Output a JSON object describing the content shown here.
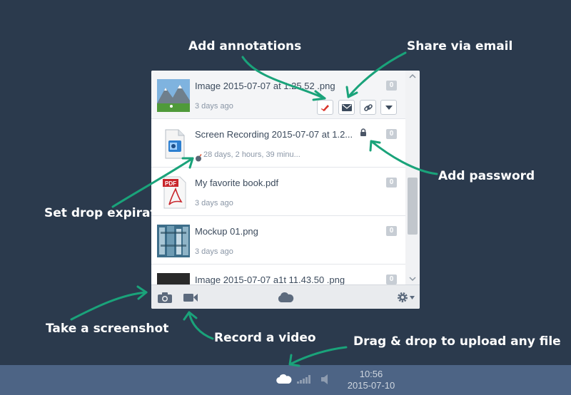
{
  "callouts": {
    "add_annotations": "Add annotations",
    "share_email": "Share via email",
    "add_password": "Add password",
    "set_expiration": "Set drop expiration",
    "take_screenshot": "Take a screenshot",
    "record_video": "Record a video",
    "drag_drop": "Drag & drop to upload any file"
  },
  "files": [
    {
      "name": "Image 2015-07-07 at 1.25.52 .png",
      "meta": "3 days ago",
      "count": "0",
      "thumb": "mountain-thumbnail"
    },
    {
      "name": "Screen Recording 2015-07-07 at 1.2...",
      "meta": "28 days, 2 hours, 39 minu...",
      "count": "0",
      "thumb": "video-file-icon"
    },
    {
      "name": "My favorite book.pdf",
      "meta": "3 days ago",
      "count": "0",
      "thumb": "pdf-file-icon"
    },
    {
      "name": "Mockup 01.png",
      "meta": "3 days ago",
      "count": "0",
      "thumb": "mockup-thumbnail"
    },
    {
      "name": "Image 2015-07-07 a1t 11.43.50 .png",
      "meta": "",
      "count": "0",
      "thumb": "dark-thumbnail"
    }
  ],
  "toolbar": {
    "icons": [
      "camera-icon",
      "video-camera-icon",
      "cloud-icon",
      "gear-icon"
    ]
  },
  "taskbar": {
    "time": "10:56",
    "date": "2015-07-10",
    "icons": [
      "cloud-icon",
      "signal-icon",
      "speaker-icon"
    ]
  },
  "colors": {
    "background": "#2b3a4d",
    "arrow": "#1aa37a",
    "taskbar": "#4d6485",
    "annotate_red": "#d9342b"
  }
}
